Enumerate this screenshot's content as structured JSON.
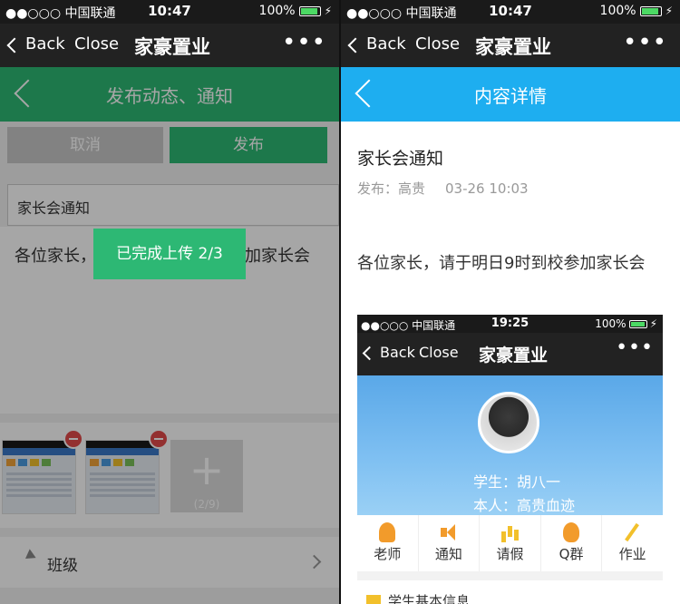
{
  "status_bar": {
    "carrier": "●●○○○ 中国联通",
    "time": "10:47",
    "battery": "100%"
  },
  "nav": {
    "back": "Back",
    "close": "Close",
    "title": "家豪置业",
    "more": "•••"
  },
  "left": {
    "header_title": "发布动态、通知",
    "cancel": "取消",
    "publish": "发布",
    "title_value": "家长会通知",
    "content_start": "各位家长，",
    "content_end": "加家长会",
    "toast": "已完成上传 2/3",
    "image_count": "(2/9)",
    "class_label": "班级"
  },
  "right": {
    "header_title": "内容详情",
    "post_title": "家长会通知",
    "publisher": "发布：高贵",
    "post_time": "03-26 10:03",
    "body": "各位家长，请于明日9时到校参加家长会",
    "embed": {
      "carrier": "●●○○○ 中国联通",
      "time": "19:25",
      "battery": "100%",
      "back": "Back",
      "close": "Close",
      "title": "家豪置业",
      "more": "•••",
      "student": "学生：胡八一",
      "self": "本人：高贵血迹",
      "menu": [
        "老师",
        "通知",
        "请假",
        "Q群",
        "作业"
      ],
      "basic_info": "学生基本信息"
    }
  },
  "colors": {
    "green": "#2db874",
    "blue": "#1eaef0",
    "navbar": "#222222"
  }
}
